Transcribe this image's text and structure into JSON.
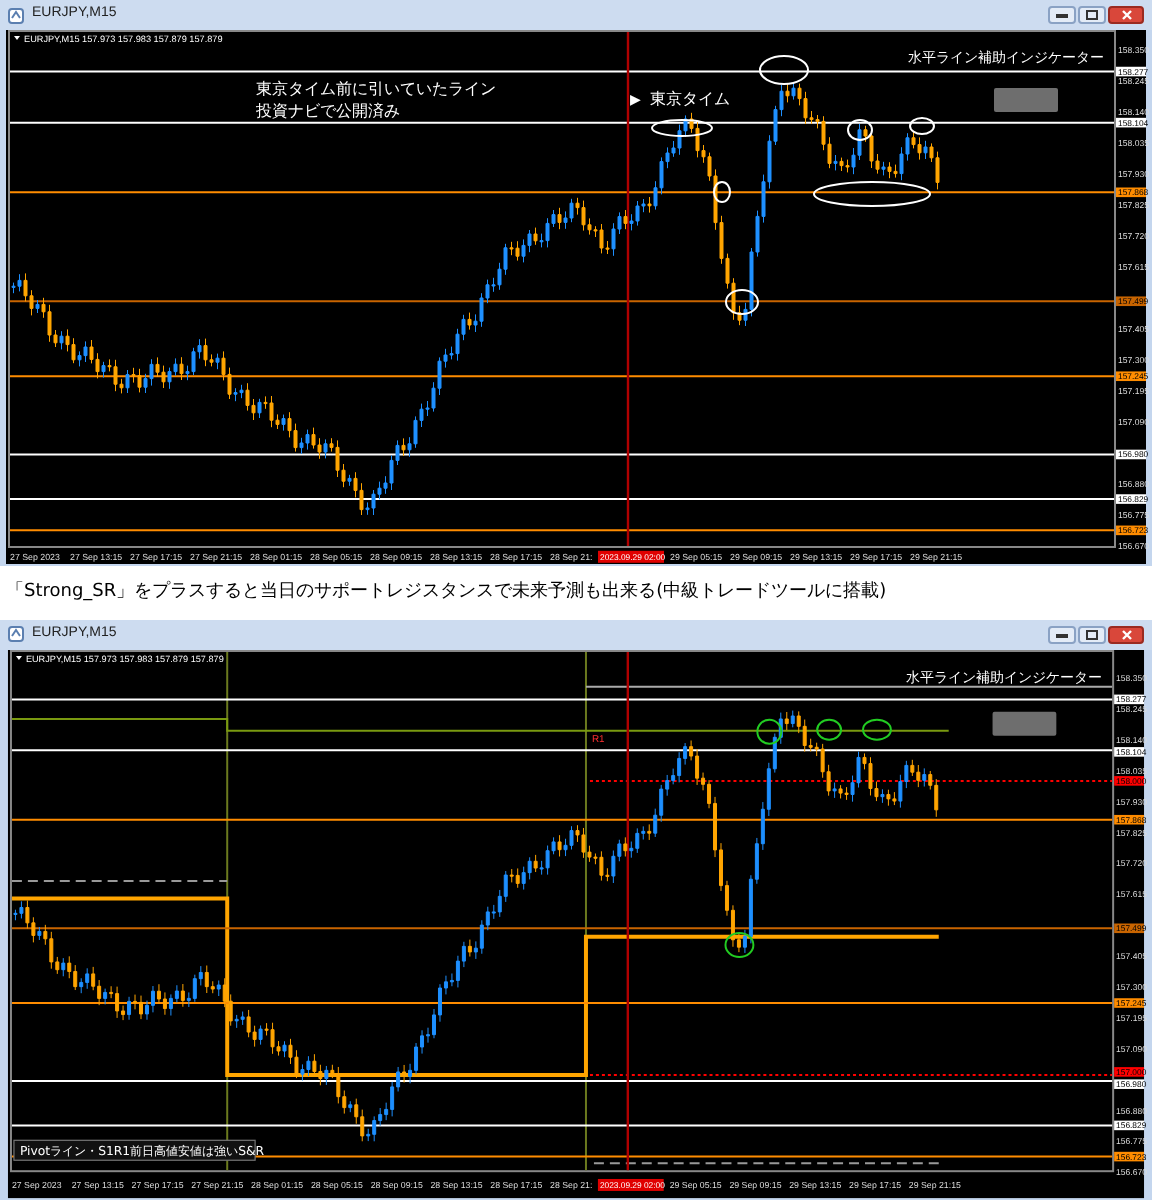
{
  "windows": [
    {
      "title": "EURJPY,M15",
      "symbol_info": "EURJPY,M15 157.973 157.983 157.879 157.879",
      "indicator_label": "水平ライン補助インジケーター",
      "notes": [
        "東京タイム前に引いていたライン",
        "投資ナビで公開済み"
      ],
      "session_marker": "▶",
      "session_label": "東京タイム",
      "price_ticks": [
        "158.350",
        "158.245",
        "158.140",
        "158.035",
        "157.930",
        "157.825",
        "157.720",
        "157.615",
        "157.405",
        "157.300",
        "157.195",
        "157.090",
        "156.880",
        "156.775",
        "156.670"
      ],
      "price_lines": [
        {
          "label": "158.277",
          "color": "#ffffff",
          "kind": "solid"
        },
        {
          "label": "158.104",
          "color": "#ffffff",
          "kind": "solid"
        },
        {
          "label": "157.868",
          "color": "#ff8c00",
          "kind": "solid"
        },
        {
          "label": "157.499",
          "color": "#c86400",
          "kind": "solid"
        },
        {
          "label": "157.245",
          "color": "#ff8c00",
          "kind": "solid"
        },
        {
          "label": "156.980",
          "color": "#ffffff",
          "kind": "solid"
        },
        {
          "label": "156.829",
          "color": "#ffffff",
          "kind": "solid"
        },
        {
          "label": "156.723",
          "color": "#ff8c00",
          "kind": "solid"
        }
      ],
      "time_labels": [
        "27 Sep 2023",
        "27 Sep 13:15",
        "27 Sep 17:15",
        "27 Sep 21:15",
        "28 Sep 01:15",
        "28 Sep 05:15",
        "28 Sep 09:15",
        "28 Sep 13:15",
        "28 Sep 17:15",
        "28 Sep 21:",
        "29 Sep 05:15",
        "29 Sep 09:15",
        "29 Sep 13:15",
        "29 Sep 17:15",
        "29 Sep 21:15"
      ],
      "cursor_time": "2023.09.29 02:00"
    },
    {
      "title": "EURJPY,M15",
      "symbol_info": "EURJPY,M15 157.973 157.983 157.879 157.879",
      "indicator_label": "水平ライン補助インジケーター",
      "level_labels": [
        "R1"
      ],
      "legend": "Pivotライン・S1R1前日高値安値は強いS&R",
      "price_ticks": [
        "158.350",
        "158.245",
        "158.140",
        "158.035",
        "157.930",
        "157.825",
        "157.720",
        "157.615",
        "157.405",
        "157.300",
        "157.195",
        "157.090",
        "156.880",
        "156.775",
        "156.670"
      ],
      "price_lines": [
        {
          "label": "158.277",
          "color": "#ffffff",
          "kind": "solid"
        },
        {
          "label": "158.104",
          "color": "#ffffff",
          "kind": "solid"
        },
        {
          "label": "158.000",
          "color": "#ff0000",
          "kind": "dotted"
        },
        {
          "label": "157.868",
          "color": "#ff8c00",
          "kind": "solid"
        },
        {
          "label": "157.499",
          "color": "#c86400",
          "kind": "solid"
        },
        {
          "label": "157.245",
          "color": "#ff8c00",
          "kind": "solid"
        },
        {
          "label": "157.000",
          "color": "#ff0000",
          "kind": "dotted"
        },
        {
          "label": "156.980",
          "color": "#ffffff",
          "kind": "solid"
        },
        {
          "label": "156.829",
          "color": "#ffffff",
          "kind": "solid"
        },
        {
          "label": "156.723",
          "color": "#ff8c00",
          "kind": "solid"
        }
      ],
      "time_labels": [
        "27 Sep 2023",
        "27 Sep 13:15",
        "27 Sep 17:15",
        "27 Sep 21:15",
        "28 Sep 01:15",
        "28 Sep 05:15",
        "28 Sep 09:15",
        "28 Sep 13:15",
        "28 Sep 17:15",
        "28 Sep 21:",
        "29 Sep 05:15",
        "29 Sep 09:15",
        "29 Sep 13:15",
        "29 Sep 17:15",
        "29 Sep 21:15"
      ],
      "cursor_time": "2023.09.29 02:00"
    }
  ],
  "caption": "「Strong_SR」をプラスすると当日のサポートレジスタンスで未来予測も出来る(中級トレードツールに搭載)"
}
